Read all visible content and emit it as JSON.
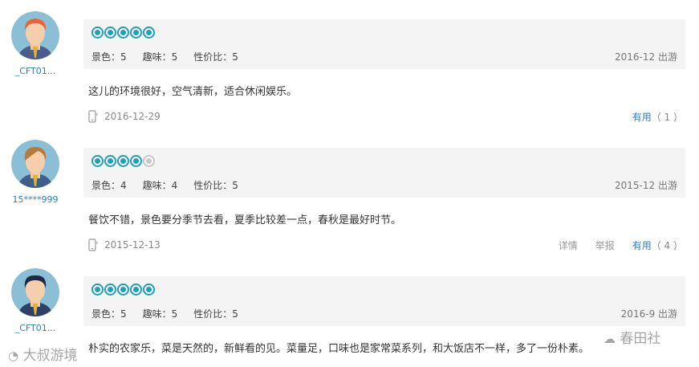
{
  "reviews": [
    {
      "username": "_CFT01...",
      "rating": 5,
      "scores": {
        "scenery": "景色：5",
        "fun": "趣味：5",
        "value": "性价比：5"
      },
      "trip": "2016-12 出游",
      "content": "这儿的环境很好，空气清新，适合休闲娱乐。",
      "date": "2016-12-29",
      "useful": "有用",
      "useful_count": "（ 1 ）"
    },
    {
      "username": "15****999",
      "rating": 4,
      "scores": {
        "scenery": "景色：4",
        "fun": "趣味：4",
        "value": "性价比：5"
      },
      "trip": "2015-12 出游",
      "content": "餐饮不错，景色要分季节去看，夏季比较差一点，春秋是最好时节。",
      "date": "2015-12-13",
      "detail": "详情",
      "report": "举报",
      "useful": "有用",
      "useful_count": "（ 4 ）"
    },
    {
      "username": "_CFT01...",
      "rating": 5,
      "scores": {
        "scenery": "景色：5",
        "fun": "趣味：5",
        "value": "性价比：5"
      },
      "trip": "2016-9 出游",
      "content": "朴实的农家乐，菜是天然的，新鲜看的见。菜量足，口味也是家常菜系列，和大饭店不一样，多了一份朴素。"
    }
  ],
  "watermarks": {
    "left": "大叔游境",
    "right": "春田社"
  },
  "colors": {
    "accent": "#1a9fc7",
    "link": "#2a7ec6",
    "panel": "#f4f4f4"
  }
}
